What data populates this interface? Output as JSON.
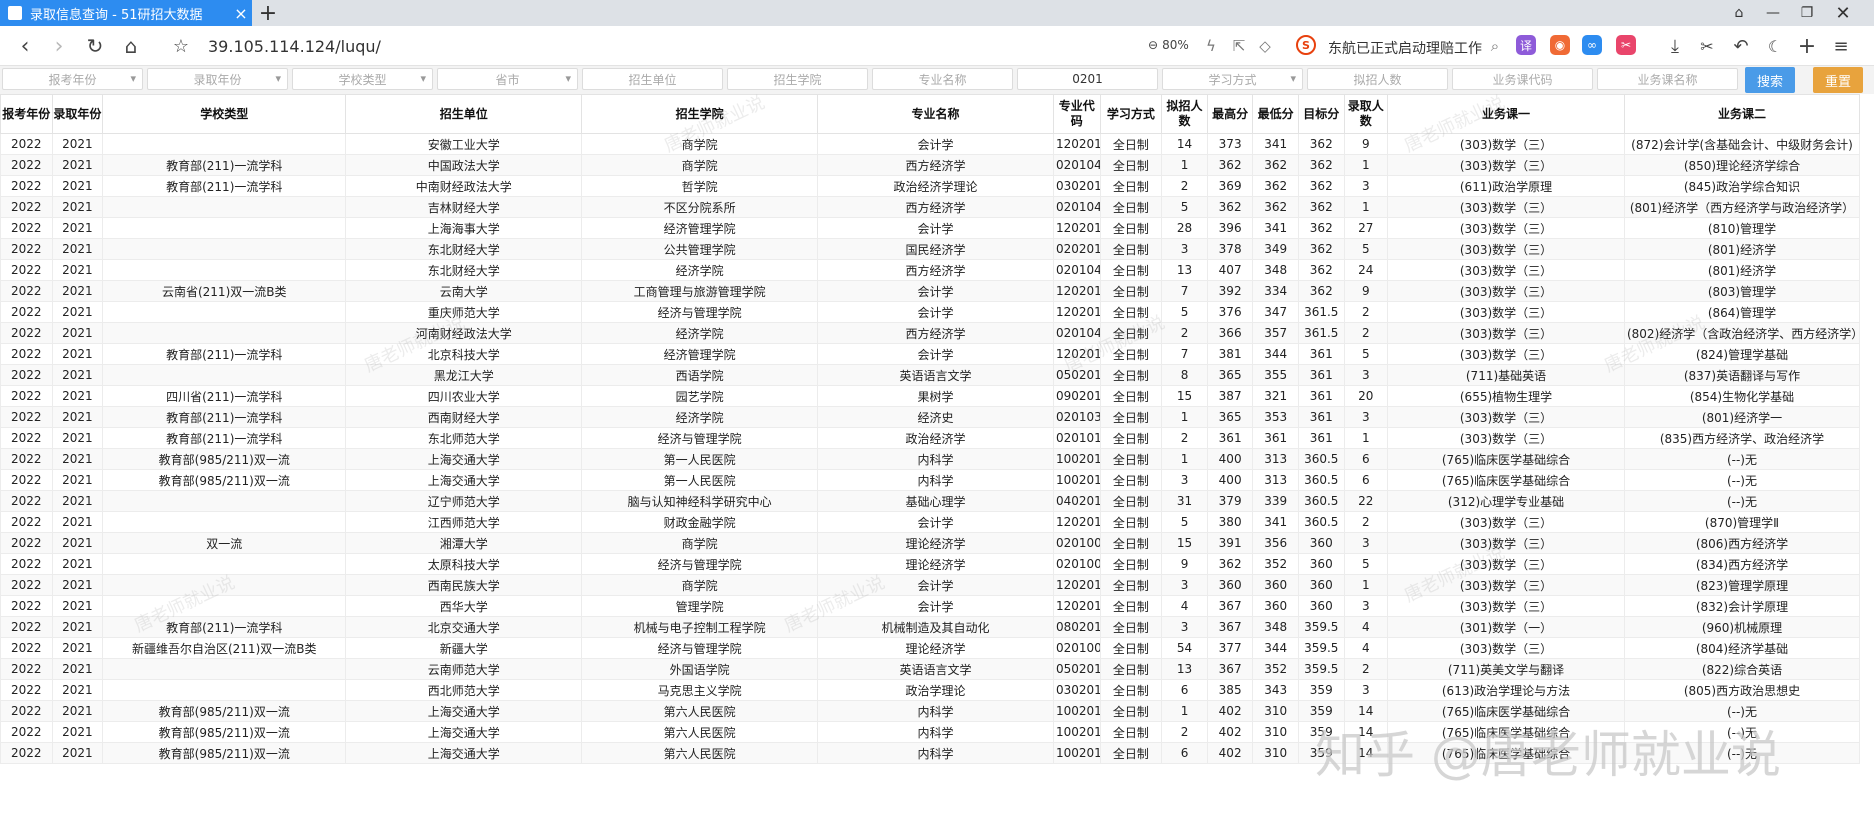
{
  "tab": {
    "title": "录取信息查询 - 51研招大数据",
    "close": "×",
    "new_tab": "+"
  },
  "address": {
    "url": "39.105.114.124/luqu/",
    "zoom": "80%",
    "news": "东航已正式启动理赔工作"
  },
  "filters": {
    "exam_year": "报考年份",
    "admit_year": "录取年份",
    "school_type": "学校类型",
    "province": "省市",
    "unit": "招生单位",
    "college": "招生学院",
    "major_name": "专业名称",
    "major_code": "0201",
    "study_mode": "学习方式",
    "plan_count": "拟招人数",
    "course_code": "业务课代码",
    "course_name": "业务课名称",
    "search_label": "搜索",
    "reset_label": "重置"
  },
  "colors": {
    "accent": "#2d8cf0",
    "search": "#4a9be8",
    "reset": "#e8a33d"
  },
  "table": {
    "headers": [
      "报考年份",
      "录取年份",
      "学校类型",
      "招生单位",
      "招生学院",
      "专业名称",
      "专业代码",
      "学习方式",
      "拟招人数",
      "最高分",
      "最低分",
      "目标分",
      "录取人数",
      "业务课一",
      "业务课二"
    ],
    "rows": [
      [
        "2022",
        "2021",
        "",
        "安徽工业大学",
        "商学院",
        "会计学",
        "120201",
        "全日制",
        "14",
        "373",
        "341",
        "362",
        "9",
        "(303)数学（三）",
        "(872)会计学(含基础会计、中级财务会计)"
      ],
      [
        "2022",
        "2021",
        "教育部(211)一流学科",
        "中国政法大学",
        "商学院",
        "西方经济学",
        "020104",
        "全日制",
        "1",
        "362",
        "362",
        "362",
        "1",
        "(303)数学（三）",
        "(850)理论经济学综合"
      ],
      [
        "2022",
        "2021",
        "教育部(211)一流学科",
        "中南财经政法大学",
        "哲学院",
        "政治经济学理论",
        "030201",
        "全日制",
        "2",
        "369",
        "362",
        "362",
        "3",
        "(611)政治学原理",
        "(845)政治学综合知识"
      ],
      [
        "2022",
        "2021",
        "",
        "吉林财经大学",
        "不区分院系所",
        "西方经济学",
        "020104",
        "全日制",
        "5",
        "362",
        "362",
        "362",
        "1",
        "(303)数学（三）",
        "(801)经济学（西方经济学与政治经济学）"
      ],
      [
        "2022",
        "2021",
        "",
        "上海海事大学",
        "经济管理学院",
        "会计学",
        "120201",
        "全日制",
        "28",
        "396",
        "341",
        "362",
        "27",
        "(303)数学（三）",
        "(810)管理学"
      ],
      [
        "2022",
        "2021",
        "",
        "东北财经大学",
        "公共管理学院",
        "国民经济学",
        "020201",
        "全日制",
        "3",
        "378",
        "349",
        "362",
        "5",
        "(303)数学（三）",
        "(801)经济学"
      ],
      [
        "2022",
        "2021",
        "",
        "东北财经大学",
        "经济学院",
        "西方经济学",
        "020104",
        "全日制",
        "13",
        "407",
        "348",
        "362",
        "24",
        "(303)数学（三）",
        "(801)经济学"
      ],
      [
        "2022",
        "2021",
        "云南省(211)双一流B类",
        "云南大学",
        "工商管理与旅游管理学院",
        "会计学",
        "120201",
        "全日制",
        "7",
        "392",
        "334",
        "362",
        "9",
        "(303)数学（三）",
        "(803)管理学"
      ],
      [
        "2022",
        "2021",
        "",
        "重庆师范大学",
        "经济与管理学院",
        "会计学",
        "120201",
        "全日制",
        "5",
        "376",
        "347",
        "361.5",
        "2",
        "(303)数学（三）",
        "(864)管理学"
      ],
      [
        "2022",
        "2021",
        "",
        "河南财经政法大学",
        "经济学院",
        "西方经济学",
        "020104",
        "全日制",
        "2",
        "366",
        "357",
        "361.5",
        "2",
        "(303)数学（三）",
        "(802)经济学（含政治经济学、西方经济学）"
      ],
      [
        "2022",
        "2021",
        "教育部(211)一流学科",
        "北京科技大学",
        "经济管理学院",
        "会计学",
        "120201",
        "全日制",
        "7",
        "381",
        "344",
        "361",
        "5",
        "(303)数学（三）",
        "(824)管理学基础"
      ],
      [
        "2022",
        "2021",
        "",
        "黑龙江大学",
        "西语学院",
        "英语语言文学",
        "050201",
        "全日制",
        "8",
        "365",
        "355",
        "361",
        "3",
        "(711)基础英语",
        "(837)英语翻译与写作"
      ],
      [
        "2022",
        "2021",
        "四川省(211)一流学科",
        "四川农业大学",
        "园艺学院",
        "果树学",
        "090201",
        "全日制",
        "15",
        "387",
        "321",
        "361",
        "20",
        "(655)植物生理学",
        "(854)生物化学基础"
      ],
      [
        "2022",
        "2021",
        "教育部(211)一流学科",
        "西南财经大学",
        "经济学院",
        "经济史",
        "020103",
        "全日制",
        "1",
        "365",
        "353",
        "361",
        "3",
        "(303)数学（三）",
        "(801)经济学一"
      ],
      [
        "2022",
        "2021",
        "教育部(211)一流学科",
        "东北师范大学",
        "经济与管理学院",
        "政治经济学",
        "020101",
        "全日制",
        "2",
        "361",
        "361",
        "361",
        "1",
        "(303)数学（三）",
        "(835)西方经济学、政治经济学"
      ],
      [
        "2022",
        "2021",
        "教育部(985/211)双一流",
        "上海交通大学",
        "第一人民医院",
        "内科学",
        "100201",
        "全日制",
        "1",
        "400",
        "313",
        "360.5",
        "6",
        "(765)临床医学基础综合",
        "(--)无"
      ],
      [
        "2022",
        "2021",
        "教育部(985/211)双一流",
        "上海交通大学",
        "第一人民医院",
        "内科学",
        "100201",
        "全日制",
        "3",
        "400",
        "313",
        "360.5",
        "6",
        "(765)临床医学基础综合",
        "(--)无"
      ],
      [
        "2022",
        "2021",
        "",
        "辽宁师范大学",
        "脑与认知神经科学研究中心",
        "基础心理学",
        "040201",
        "全日制",
        "31",
        "379",
        "339",
        "360.5",
        "22",
        "(312)心理学专业基础",
        "(--)无"
      ],
      [
        "2022",
        "2021",
        "",
        "江西师范大学",
        "财政金融学院",
        "会计学",
        "120201",
        "全日制",
        "5",
        "380",
        "341",
        "360.5",
        "2",
        "(303)数学（三）",
        "(870)管理学Ⅱ"
      ],
      [
        "2022",
        "2021",
        "双一流",
        "湘潭大学",
        "商学院",
        "理论经济学",
        "020100",
        "全日制",
        "15",
        "391",
        "356",
        "360",
        "3",
        "(303)数学（三）",
        "(806)西方经济学"
      ],
      [
        "2022",
        "2021",
        "",
        "太原科技大学",
        "经济与管理学院",
        "理论经济学",
        "020100",
        "全日制",
        "9",
        "362",
        "352",
        "360",
        "5",
        "(303)数学（三）",
        "(834)西方经济学"
      ],
      [
        "2022",
        "2021",
        "",
        "西南民族大学",
        "商学院",
        "会计学",
        "120201",
        "全日制",
        "3",
        "360",
        "360",
        "360",
        "1",
        "(303)数学（三）",
        "(823)管理学原理"
      ],
      [
        "2022",
        "2021",
        "",
        "西华大学",
        "管理学院",
        "会计学",
        "120201",
        "全日制",
        "4",
        "367",
        "360",
        "360",
        "3",
        "(303)数学（三）",
        "(832)会计学原理"
      ],
      [
        "2022",
        "2021",
        "教育部(211)一流学科",
        "北京交通大学",
        "机械与电子控制工程学院",
        "机械制造及其自动化",
        "080201",
        "全日制",
        "3",
        "367",
        "348",
        "359.5",
        "4",
        "(301)数学（一）",
        "(960)机械原理"
      ],
      [
        "2022",
        "2021",
        "新疆维吾尔自治区(211)双一流B类",
        "新疆大学",
        "经济与管理学院",
        "理论经济学",
        "020100",
        "全日制",
        "54",
        "377",
        "344",
        "359.5",
        "4",
        "(303)数学（三）",
        "(804)经济学基础"
      ],
      [
        "2022",
        "2021",
        "",
        "云南师范大学",
        "外国语学院",
        "英语语言文学",
        "050201",
        "全日制",
        "13",
        "367",
        "352",
        "359.5",
        "2",
        "(711)英美文学与翻译",
        "(822)综合英语"
      ],
      [
        "2022",
        "2021",
        "",
        "西北师范大学",
        "马克思主义学院",
        "政治学理论",
        "030201",
        "全日制",
        "6",
        "385",
        "343",
        "359",
        "3",
        "(613)政治学理论与方法",
        "(805)西方政治思想史"
      ],
      [
        "2022",
        "2021",
        "教育部(985/211)双一流",
        "上海交通大学",
        "第六人民医院",
        "内科学",
        "100201",
        "全日制",
        "1",
        "402",
        "310",
        "359",
        "14",
        "(765)临床医学基础综合",
        "(--)无"
      ],
      [
        "2022",
        "2021",
        "教育部(985/211)双一流",
        "上海交通大学",
        "第六人民医院",
        "内科学",
        "100201",
        "全日制",
        "2",
        "402",
        "310",
        "359",
        "14",
        "(765)临床医学基础综合",
        "(--)无"
      ],
      [
        "2022",
        "2021",
        "教育部(985/211)双一流",
        "上海交通大学",
        "第六人民医院",
        "内科学",
        "100201",
        "全日制",
        "6",
        "402",
        "310",
        "359",
        "14",
        "(765)临床医学基础综合",
        "(--)无"
      ]
    ]
  },
  "watermark": {
    "text": "唐老师就业说",
    "zhihu": "知乎 @唐老师就业说"
  }
}
